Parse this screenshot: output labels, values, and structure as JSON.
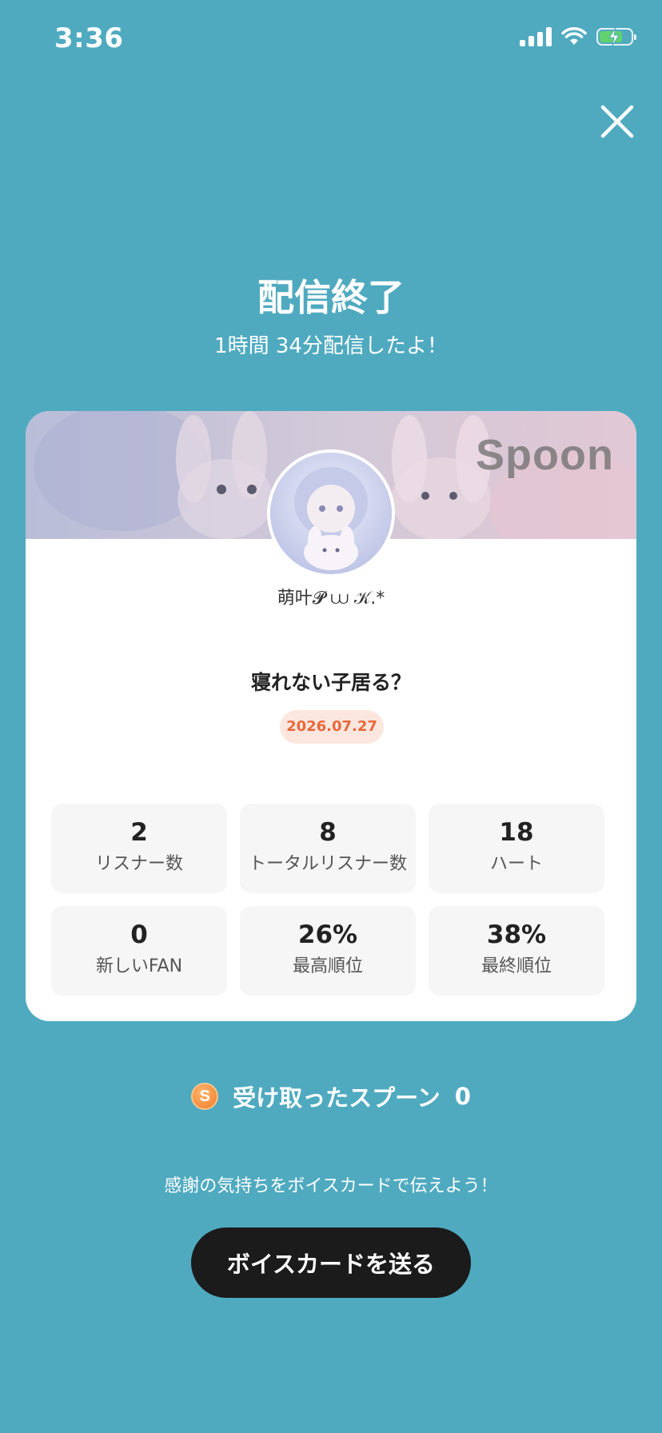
{
  "status_bar": {
    "time": "3:36",
    "icons": [
      "signal-icon",
      "wifi-icon",
      "battery-charging-icon"
    ]
  },
  "close_icon": "close-icon",
  "header": {
    "title": "配信終了",
    "subtitle": "1時間 34分配信したよ！"
  },
  "card": {
    "brand": "Spoon",
    "username": "萌叶𝓟 ⩊ 𝒦.*",
    "cast_title": "寝れない子居る？",
    "date": "2026.07.27",
    "stats": [
      {
        "value": "2",
        "label": "リスナー数"
      },
      {
        "value": "8",
        "label": "トータルリスナー数"
      },
      {
        "value": "18",
        "label": "ハート"
      },
      {
        "value": "0",
        "label": "新しいFAN"
      },
      {
        "value": "26%",
        "label": "最高順位"
      },
      {
        "value": "38%",
        "label": "最終順位"
      }
    ]
  },
  "spoon": {
    "coin_letter": "S",
    "label": "受け取ったスプーン",
    "count": "0"
  },
  "footer": {
    "thanks": "感謝の気持ちをボイスカードで伝えよう！",
    "button_label": "ボイスカードを送る"
  },
  "colors": {
    "background": "#4faac0",
    "date_badge_text": "#e8683a",
    "date_badge_bg": "#fce7df",
    "button_bg": "#1b1b1b",
    "coin": "#f07a2a"
  }
}
